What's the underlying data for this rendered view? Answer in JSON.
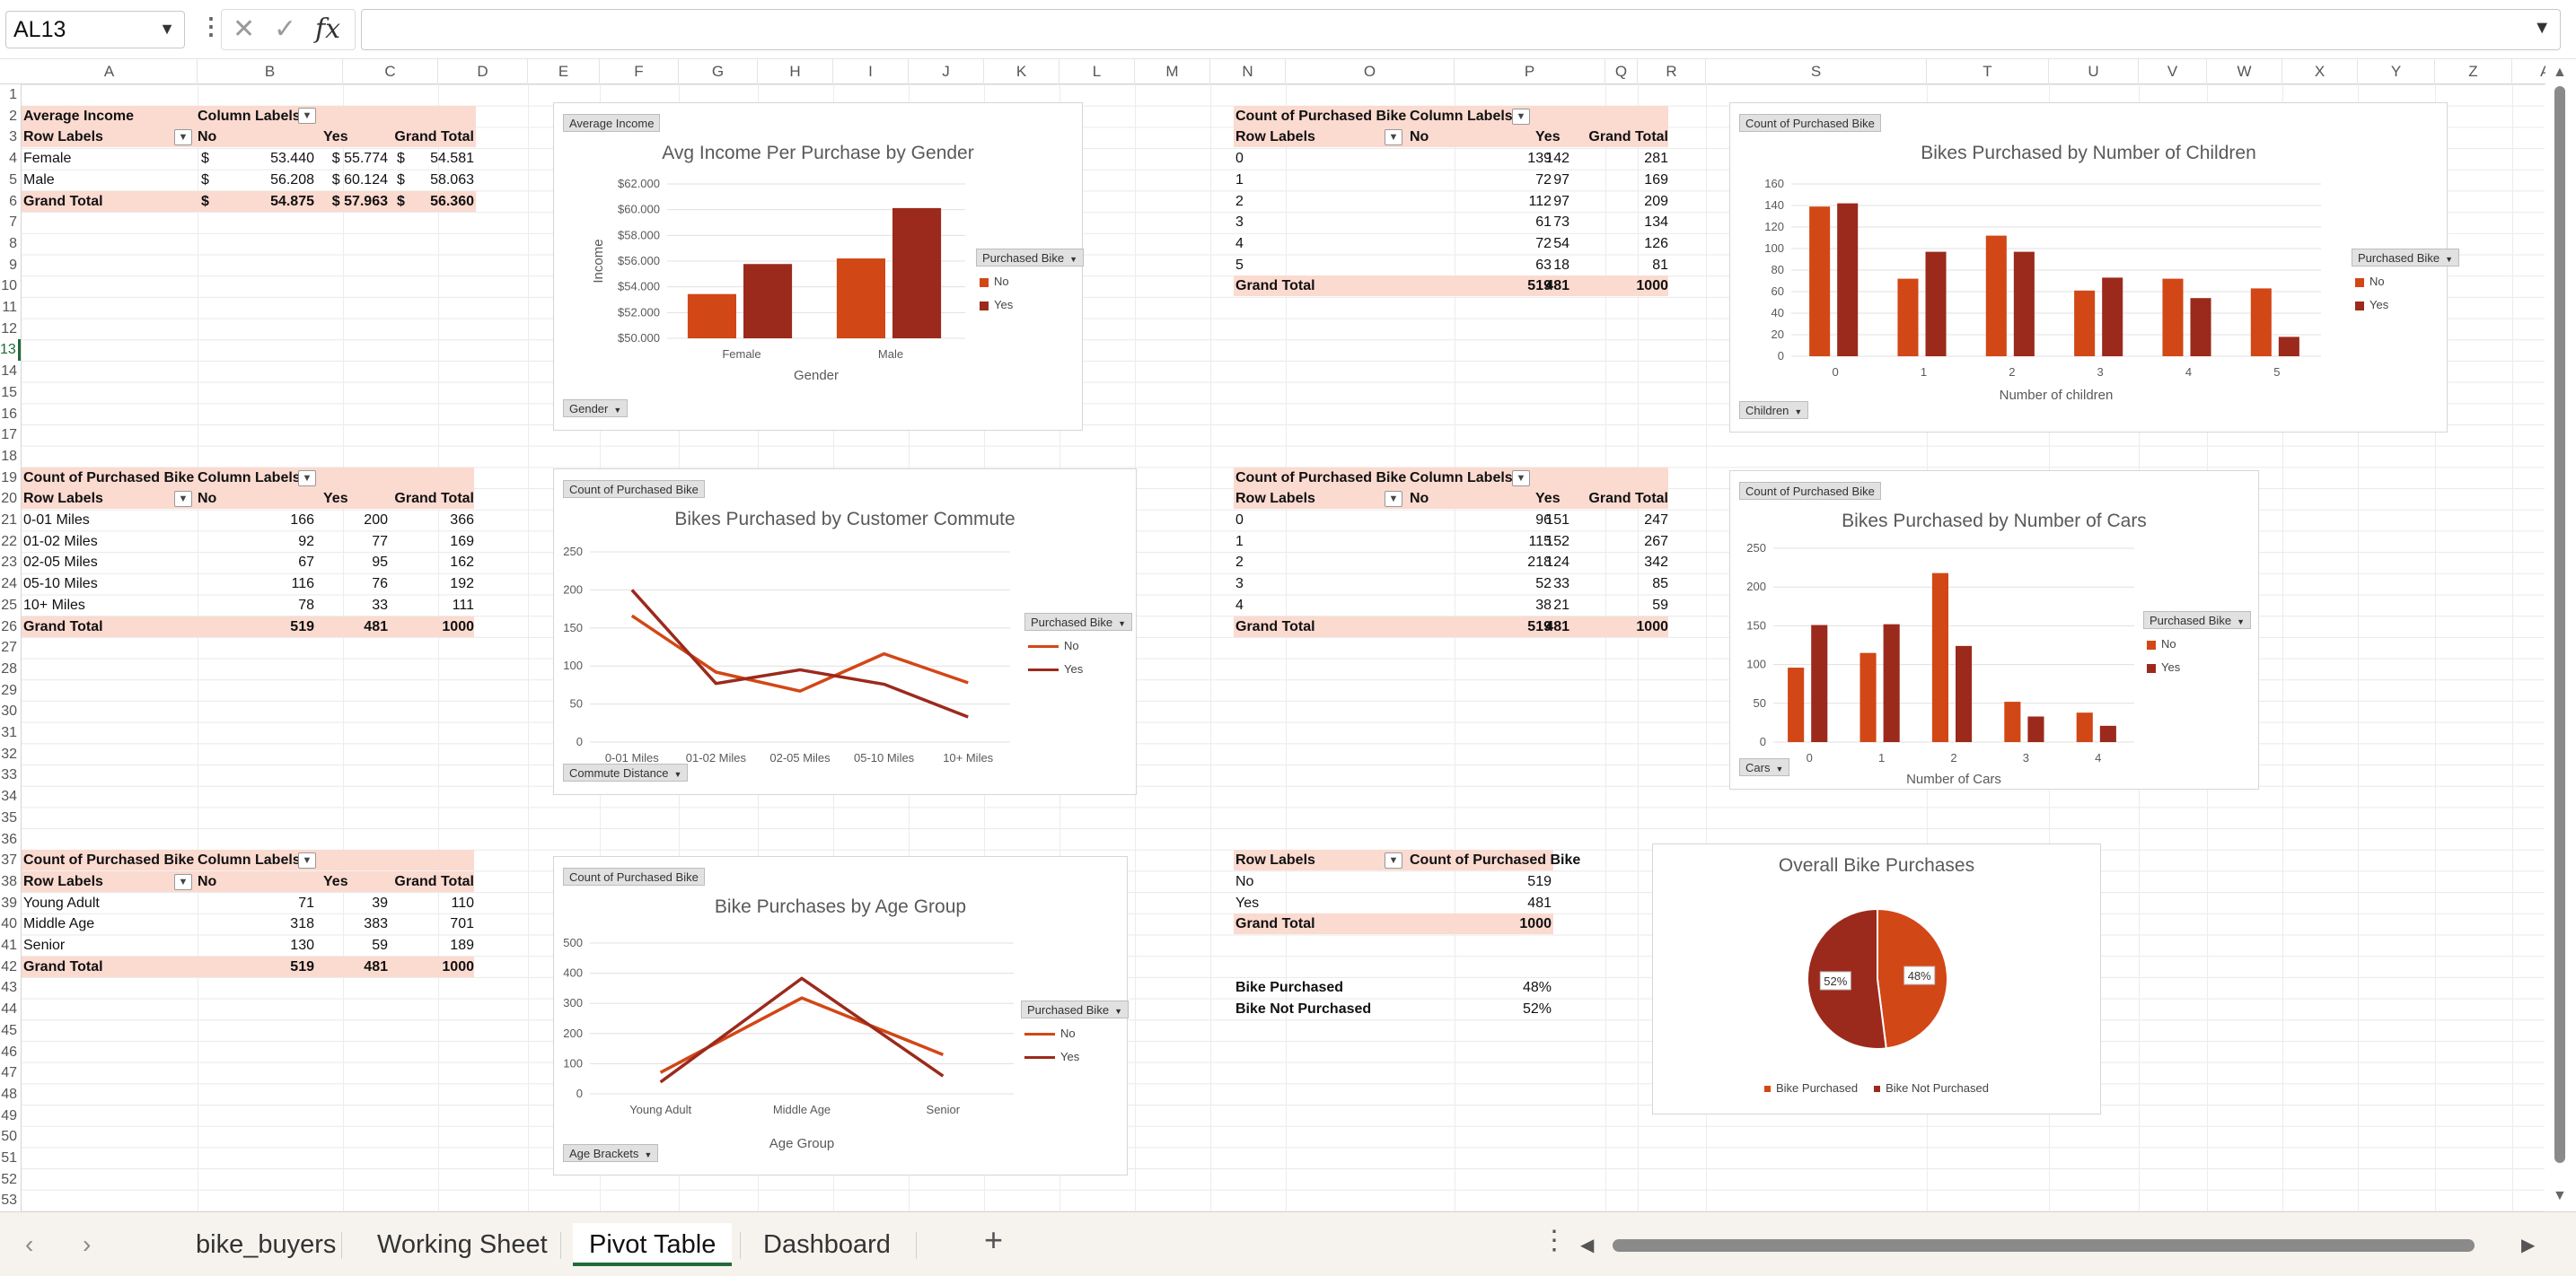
{
  "formula_bar": {
    "name_box": "AL13",
    "formula": ""
  },
  "columns": [
    "A",
    "B",
    "C",
    "D",
    "E",
    "F",
    "G",
    "H",
    "I",
    "J",
    "K",
    "L",
    "M",
    "N",
    "O",
    "P",
    "Q",
    "R",
    "S",
    "T",
    "U",
    "V",
    "W",
    "X",
    "Y",
    "Z",
    "AA"
  ],
  "rows": [
    "1",
    "2",
    "3",
    "4",
    "5",
    "6",
    "7",
    "8",
    "9",
    "10",
    "11",
    "12",
    "13",
    "14",
    "15",
    "16",
    "17",
    "18",
    "19",
    "20",
    "21",
    "22",
    "23",
    "24",
    "25",
    "26",
    "27",
    "28",
    "29",
    "30",
    "31",
    "32",
    "33",
    "34",
    "35",
    "36",
    "37",
    "38",
    "39",
    "40",
    "41",
    "42",
    "43",
    "44",
    "45",
    "46",
    "47",
    "48",
    "49",
    "50",
    "51",
    "52",
    "53"
  ],
  "pt_income": {
    "title": "Average Income",
    "col_labels": "Column Labels",
    "row_labels": "Row Labels",
    "headers": [
      "No",
      "Yes",
      "Grand Total"
    ],
    "rows": [
      {
        "label": "Female",
        "no": "53.440",
        "yes": "$ 55.774",
        "total": "54.581"
      },
      {
        "label": "Male",
        "no": "56.208",
        "yes": "$ 60.124",
        "total": "58.063"
      }
    ],
    "grand": {
      "label": "Grand Total",
      "no": "54.875",
      "yes": "$ 57.963",
      "total": "56.360"
    },
    "currency": "$"
  },
  "pt_commute": {
    "title": "Count of Purchased Bike",
    "col_labels": "Column Labels",
    "row_labels": "Row Labels",
    "headers": [
      "No",
      "Yes",
      "Grand Total"
    ],
    "rows": [
      {
        "label": "0-01 Miles",
        "no": "166",
        "yes": "200",
        "total": "366"
      },
      {
        "label": "01-02 Miles",
        "no": "92",
        "yes": "77",
        "total": "169"
      },
      {
        "label": "02-05 Miles",
        "no": "67",
        "yes": "95",
        "total": "162"
      },
      {
        "label": "05-10 Miles",
        "no": "116",
        "yes": "76",
        "total": "192"
      },
      {
        "label": "10+ Miles",
        "no": "78",
        "yes": "33",
        "total": "111"
      }
    ],
    "grand": {
      "label": "Grand Total",
      "no": "519",
      "yes": "481",
      "total": "1000"
    }
  },
  "pt_age": {
    "title": "Count of Purchased Bike",
    "col_labels": "Column Labels",
    "row_labels": "Row Labels",
    "headers": [
      "No",
      "Yes",
      "Grand Total"
    ],
    "rows": [
      {
        "label": " Young Adult",
        "no": "71",
        "yes": "39",
        "total": "110"
      },
      {
        "label": "Middle Age",
        "no": "318",
        "yes": "383",
        "total": "701"
      },
      {
        "label": "Senior",
        "no": "130",
        "yes": "59",
        "total": "189"
      }
    ],
    "grand": {
      "label": "Grand Total",
      "no": "519",
      "yes": "481",
      "total": "1000"
    }
  },
  "pt_children": {
    "title": "Count of Purchased Bike",
    "col_labels": "Column Labels",
    "row_labels": "Row Labels",
    "headers": [
      "No",
      "Yes",
      "Grand Total"
    ],
    "rows": [
      {
        "label": "0",
        "no": "139",
        "yes": "142",
        "total": "281"
      },
      {
        "label": "1",
        "no": "72",
        "yes": "97",
        "total": "169"
      },
      {
        "label": "2",
        "no": "112",
        "yes": "97",
        "total": "209"
      },
      {
        "label": "3",
        "no": "61",
        "yes": "73",
        "total": "134"
      },
      {
        "label": "4",
        "no": "72",
        "yes": "54",
        "total": "126"
      },
      {
        "label": "5",
        "no": "63",
        "yes": "18",
        "total": "81"
      }
    ],
    "grand": {
      "label": "Grand Total",
      "no": "519",
      "yes": "481",
      "total": "1000"
    }
  },
  "pt_cars": {
    "title": "Count of Purchased Bike",
    "col_labels": "Column Labels",
    "row_labels": "Row Labels",
    "headers": [
      "No",
      "Yes",
      "Grand Total"
    ],
    "rows": [
      {
        "label": "0",
        "no": "96",
        "yes": "151",
        "total": "247"
      },
      {
        "label": "1",
        "no": "115",
        "yes": "152",
        "total": "267"
      },
      {
        "label": "2",
        "no": "218",
        "yes": "124",
        "total": "342"
      },
      {
        "label": "3",
        "no": "52",
        "yes": "33",
        "total": "85"
      },
      {
        "label": "4",
        "no": "38",
        "yes": "21",
        "total": "59"
      }
    ],
    "grand": {
      "label": "Grand Total",
      "no": "519",
      "yes": "481",
      "total": "1000"
    }
  },
  "pt_overall": {
    "row_labels": "Row Labels",
    "value_header": "Count of Purchased Bike",
    "rows": [
      {
        "label": "No",
        "value": "519"
      },
      {
        "label": "Yes",
        "value": "481"
      }
    ],
    "grand": {
      "label": "Grand Total",
      "value": "1000"
    },
    "pct": [
      {
        "label": "Bike Purchased",
        "value": "48%"
      },
      {
        "label": "Bike Not Purchased",
        "value": "52%"
      }
    ]
  },
  "colors": {
    "no": "#d24716",
    "yes": "#9b2a1c",
    "header_fill": "#fbdad0",
    "active_tab": "#1f6b3a"
  },
  "chart_data": [
    {
      "type": "bar",
      "title": "Avg Income Per Purchase by Gender",
      "field_button": "Average Income",
      "axis_button": "Gender",
      "legend_button": "Purchased Bike",
      "xlabel": "Gender",
      "ylabel": "Income",
      "categories": [
        "Female",
        "Male"
      ],
      "series": [
        {
          "name": "No",
          "values": [
            53440,
            56208
          ]
        },
        {
          "name": "Yes",
          "values": [
            55774,
            60124
          ]
        }
      ],
      "ylim": [
        50000,
        62000
      ],
      "yticks": [
        "$50.000",
        "$52.000",
        "$54.000",
        "$56.000",
        "$58.000",
        "$60.000",
        "$62.000"
      ],
      "legend": "right",
      "grid": true
    },
    {
      "type": "bar",
      "title": "Bikes Purchased by Number of Children",
      "field_button": "Count of Purchased Bike",
      "axis_button": "Children",
      "legend_button": "Purchased Bike",
      "xlabel": "Number of children",
      "ylabel": "",
      "categories": [
        "0",
        "1",
        "2",
        "3",
        "4",
        "5"
      ],
      "series": [
        {
          "name": "No",
          "values": [
            139,
            72,
            112,
            61,
            72,
            63
          ]
        },
        {
          "name": "Yes",
          "values": [
            142,
            97,
            97,
            73,
            54,
            18
          ]
        }
      ],
      "ylim": [
        0,
        160
      ],
      "yticks": [
        "0",
        "20",
        "40",
        "60",
        "80",
        "100",
        "120",
        "140",
        "160"
      ],
      "legend": "right",
      "grid": true
    },
    {
      "type": "line",
      "title": "Bikes Purchased by Customer Commute",
      "field_button": "Count of Purchased Bike",
      "axis_button": "Commute Distance",
      "legend_button": "Purchased Bike",
      "xlabel": "",
      "ylabel": "",
      "categories": [
        "0-01 Miles",
        "01-02 Miles",
        "02-05 Miles",
        "05-10 Miles",
        "10+ Miles"
      ],
      "series": [
        {
          "name": "No",
          "values": [
            166,
            92,
            67,
            116,
            78
          ]
        },
        {
          "name": "Yes",
          "values": [
            200,
            77,
            95,
            76,
            33
          ]
        }
      ],
      "ylim": [
        0,
        250
      ],
      "yticks": [
        "0",
        "50",
        "100",
        "150",
        "200",
        "250"
      ],
      "legend": "right",
      "grid": true
    },
    {
      "type": "bar",
      "title": "Bikes Purchased by Number of Cars",
      "field_button": "Count of Purchased Bike",
      "axis_button": "Cars",
      "legend_button": "Purchased Bike",
      "xlabel": "Number of Cars",
      "ylabel": "",
      "categories": [
        "0",
        "1",
        "2",
        "3",
        "4"
      ],
      "series": [
        {
          "name": "No",
          "values": [
            96,
            115,
            218,
            52,
            38
          ]
        },
        {
          "name": "Yes",
          "values": [
            151,
            152,
            124,
            33,
            21
          ]
        }
      ],
      "ylim": [
        0,
        250
      ],
      "yticks": [
        "0",
        "50",
        "100",
        "150",
        "200",
        "250"
      ],
      "legend": "right",
      "grid": true
    },
    {
      "type": "line",
      "title": "Bike Purchases by Age Group",
      "field_button": "Count of Purchased Bike",
      "axis_button": "Age Brackets",
      "legend_button": "Purchased Bike",
      "xlabel": "Age Group",
      "ylabel": "",
      "categories": [
        "Young Adult",
        "Middle Age",
        "Senior"
      ],
      "series": [
        {
          "name": "No",
          "values": [
            71,
            318,
            130
          ]
        },
        {
          "name": "Yes",
          "values": [
            39,
            383,
            59
          ]
        }
      ],
      "ylim": [
        0,
        500
      ],
      "yticks": [
        "0",
        "100",
        "200",
        "300",
        "400",
        "500"
      ],
      "legend": "right",
      "grid": true
    },
    {
      "type": "pie",
      "title": "Overall Bike Purchases",
      "categories": [
        "Bike Purchased",
        "Bike Not Purchased"
      ],
      "values": [
        48,
        52
      ],
      "labels": [
        "48%",
        "52%"
      ],
      "legend": "bottom"
    }
  ],
  "tabs": [
    "bike_buyers",
    "Working Sheet",
    "Pivot Table",
    "Dashboard"
  ],
  "active_tab": "Pivot Table"
}
